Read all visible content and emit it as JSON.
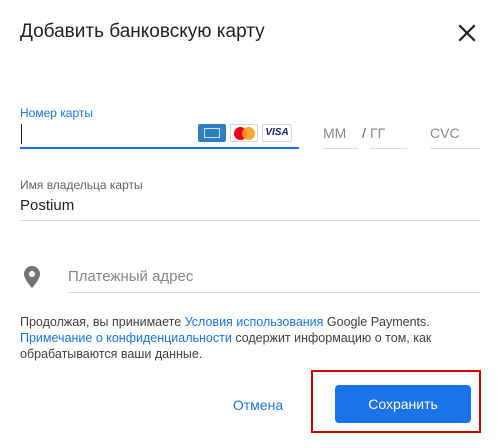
{
  "dialog": {
    "title": "Добавить банковскую карту",
    "close_icon": "close-icon"
  },
  "card": {
    "number_label": "Номер карты",
    "number_value": "",
    "brands": [
      "AMEX",
      "MasterCard",
      "VISA"
    ],
    "month_placeholder": "ММ",
    "separator": "/",
    "year_placeholder": "ГГ",
    "cvc_placeholder": "CVC"
  },
  "holder": {
    "label": "Имя владельца карты",
    "value": "Postium"
  },
  "billing": {
    "icon": "location-pin-icon",
    "placeholder": "Платежный адрес"
  },
  "legal": {
    "part1": "Продолжая, вы принимаете ",
    "terms_link": "Условия использования",
    "part2": " Google Payments.",
    "privacy_link": "Примечание о конфиденциальности",
    "part3": " содержит информацию о том, как обрабатываются ваши данные."
  },
  "actions": {
    "cancel_label": "Отмена",
    "save_label": "Сохранить"
  },
  "colors": {
    "accent": "#1a73e8",
    "highlight": "#d10000"
  }
}
